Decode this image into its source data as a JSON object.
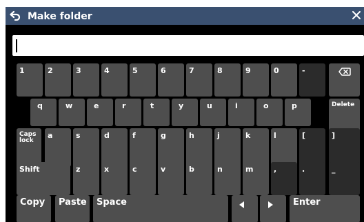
{
  "title": "Make folder",
  "input": {
    "value": ""
  },
  "icons": {
    "back": "back-arrow-icon",
    "close": "close-icon",
    "backspace": "backspace-icon",
    "left": "left-arrow-icon",
    "right": "right-arrow-icon"
  },
  "colors": {
    "titlebar": "#3a5070",
    "key": "#4e4e4e",
    "key_dark": "#2b2b2b"
  },
  "keyboard": {
    "row1": [
      "1",
      "2",
      "3",
      "4",
      "5",
      "6",
      "7",
      "8",
      "9",
      "0",
      "-"
    ],
    "row2": [
      "q",
      "w",
      "e",
      "r",
      "t",
      "y",
      "u",
      "i",
      "o",
      "p"
    ],
    "delete": "Delete",
    "caps": "Caps\nlock",
    "row3": [
      "a",
      "s",
      "d",
      "f",
      "g",
      "h",
      "j",
      "k",
      "l",
      "[",
      "]"
    ],
    "shift": "Shift",
    "row4": [
      "z",
      "x",
      "c",
      "v",
      "b",
      "n",
      "m",
      ",",
      ".",
      "_"
    ],
    "copy": "Copy",
    "paste": "Paste",
    "space": "Space",
    "enter": "Enter"
  }
}
